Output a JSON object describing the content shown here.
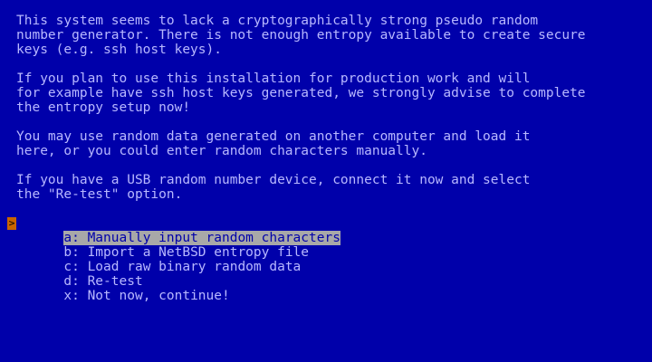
{
  "message": {
    "paragraphs": [
      [
        "This system seems to lack a cryptographically strong pseudo random",
        "number generator. There is not enough entropy available to create secure",
        "keys (e.g. ssh host keys)."
      ],
      [
        "If you plan to use this installation for production work and will",
        "for example have ssh host keys generated, we strongly advise to complete",
        "the entropy setup now!"
      ],
      [
        "You may use random data generated on another computer and load it",
        "here, or you could enter random characters manually."
      ],
      [
        "If you have a USB random number device, connect it now and select",
        "the \"Re-test\" option."
      ]
    ]
  },
  "menu": {
    "cursor_glyph": ">",
    "items": [
      {
        "label": "a: Manually input random characters",
        "selected": true
      },
      {
        "label": "b: Import a NetBSD entropy file",
        "selected": false
      },
      {
        "label": "c: Load raw binary random data",
        "selected": false
      },
      {
        "label": "d: Re-test",
        "selected": false
      },
      {
        "label": "x: Not now, continue!",
        "selected": false
      }
    ]
  },
  "colors": {
    "background": "#0000aa",
    "text": "#b8b8ff",
    "highlight": "#a8a8a8",
    "cursor": "#c86400"
  }
}
